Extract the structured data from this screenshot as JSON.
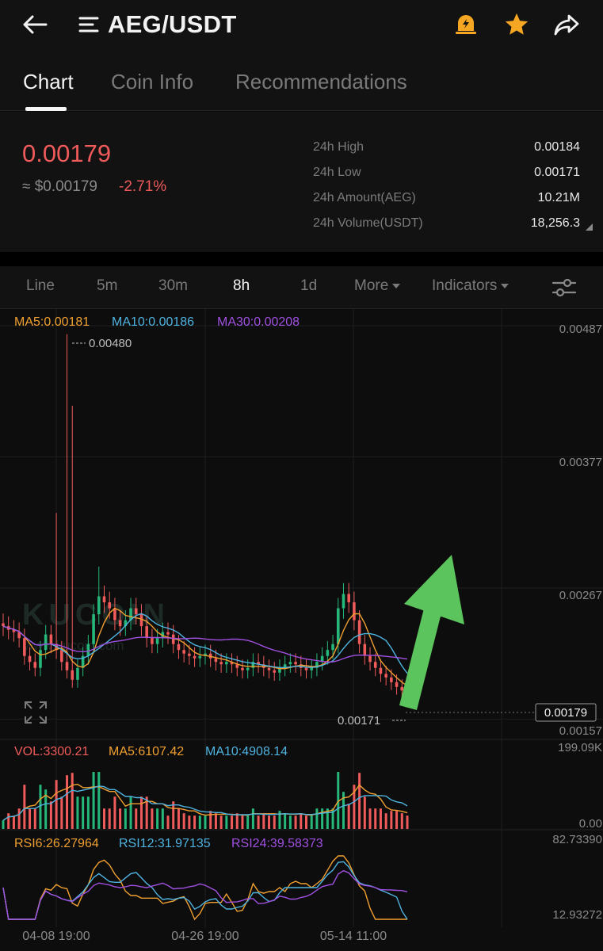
{
  "header": {
    "back_icon": "arrow-left-icon",
    "menu_icon": "list-menu-icon",
    "title": "AEG/USDT",
    "alert_icon": "price-alert-bell-icon",
    "favorite_icon": "star-icon",
    "share_icon": "share-icon",
    "accent_color": "#f5a623"
  },
  "tabs": [
    {
      "label": "Chart",
      "active": true
    },
    {
      "label": "Coin Info",
      "active": false
    },
    {
      "label": "Recommendations",
      "active": false
    }
  ],
  "summary": {
    "last_price": "0.00179",
    "fiat_price": "≈ $0.00179",
    "change": "-2.71%",
    "stats": [
      {
        "label": "24h High",
        "value": "0.00184"
      },
      {
        "label": "24h Low",
        "value": "0.00171"
      },
      {
        "label": "24h Amount(AEG)",
        "value": "10.21M"
      },
      {
        "label": "24h Volume(USDT)",
        "value": "18,256.3"
      }
    ]
  },
  "intervals": {
    "items": [
      "Line",
      "5m",
      "30m",
      "8h",
      "1d"
    ],
    "active": "8h",
    "more_label": "More",
    "indicators_label": "Indicators"
  },
  "chart_data": {
    "type": "candlestick",
    "pair": "AEG/USDT",
    "interval": "8h",
    "watermark": "KUCOIN",
    "watermark_url": "www.kucoin.com",
    "ma_legend": [
      {
        "label": "MA5:0.00181",
        "color": "#f0a030"
      },
      {
        "label": "MA10:0.00186",
        "color": "#4fb3e0"
      },
      {
        "label": "MA30:0.00208",
        "color": "#a050e0"
      }
    ],
    "y_ticks": [
      "0.00487",
      "0.00377",
      "0.00267",
      "0.00157"
    ],
    "y_tick_values": [
      0.00487,
      0.00377,
      0.00267,
      0.00157
    ],
    "ylim": [
      0.00142,
      0.00497
    ],
    "max_marker": "0.00480",
    "max_value": 0.0048,
    "min_marker": "0.00171",
    "min_value": 0.00171,
    "current_price_label": "0.00179",
    "current_price": 0.00179,
    "x_ticks": [
      "04-08 19:00",
      "04-26 19:00",
      "05-14 11:00"
    ],
    "up_color": "#26b77a",
    "down_color": "#ef5a5a",
    "close_series": [
      0.00235,
      0.00232,
      0.0023,
      0.00225,
      0.0021,
      0.00205,
      0.002,
      0.00215,
      0.00228,
      0.0022,
      0.00215,
      0.00205,
      0.00198,
      0.0019,
      0.002,
      0.0021,
      0.0022,
      0.00245,
      0.0026,
      0.00255,
      0.0025,
      0.0024,
      0.00235,
      0.0024,
      0.0025,
      0.00245,
      0.00235,
      0.00225,
      0.0022,
      0.00225,
      0.0023,
      0.00228,
      0.0022,
      0.00215,
      0.00212,
      0.0021,
      0.00208,
      0.0021,
      0.00212,
      0.00208,
      0.00205,
      0.00203,
      0.00205,
      0.00203,
      0.002,
      0.00198,
      0.002,
      0.00205,
      0.00203,
      0.002,
      0.00198,
      0.00196,
      0.002,
      0.00203,
      0.00205,
      0.00203,
      0.002,
      0.00198,
      0.002,
      0.00205,
      0.0021,
      0.00215,
      0.0022,
      0.0025,
      0.00262,
      0.00255,
      0.0024,
      0.0022,
      0.0021,
      0.00205,
      0.002,
      0.00195,
      0.00192,
      0.00188,
      0.00184,
      0.00181,
      0.00179
    ],
    "spikes": [
      {
        "index": 10,
        "high": 0.0033
      },
      {
        "index": 12,
        "high": 0.0048
      },
      {
        "index": 13,
        "high": 0.0042
      },
      {
        "index": 18,
        "high": 0.00285
      }
    ],
    "volume": {
      "legend": [
        {
          "label": "VOL:3300.21",
          "color": "#ef5a5a"
        },
        {
          "label": "MA5:6107.42",
          "color": "#f0a030"
        },
        {
          "label": "MA10:4908.14",
          "color": "#4fb3e0"
        }
      ],
      "y_ticks": [
        "199.09K",
        "0.00"
      ],
      "ylim": [
        0,
        199090
      ]
    },
    "rsi": {
      "legend": [
        {
          "label": "RSI6:26.27964",
          "color": "#f0a030"
        },
        {
          "label": "RSI12:31.97135",
          "color": "#4fb3e0"
        },
        {
          "label": "RSI24:39.58373",
          "color": "#a050e0"
        }
      ],
      "y_ticks": [
        "82.73390",
        "12.93272"
      ],
      "ylim": [
        12.93272,
        82.7339
      ]
    },
    "annotation": "green-up-arrow",
    "annotation_color": "#5cc45c"
  }
}
